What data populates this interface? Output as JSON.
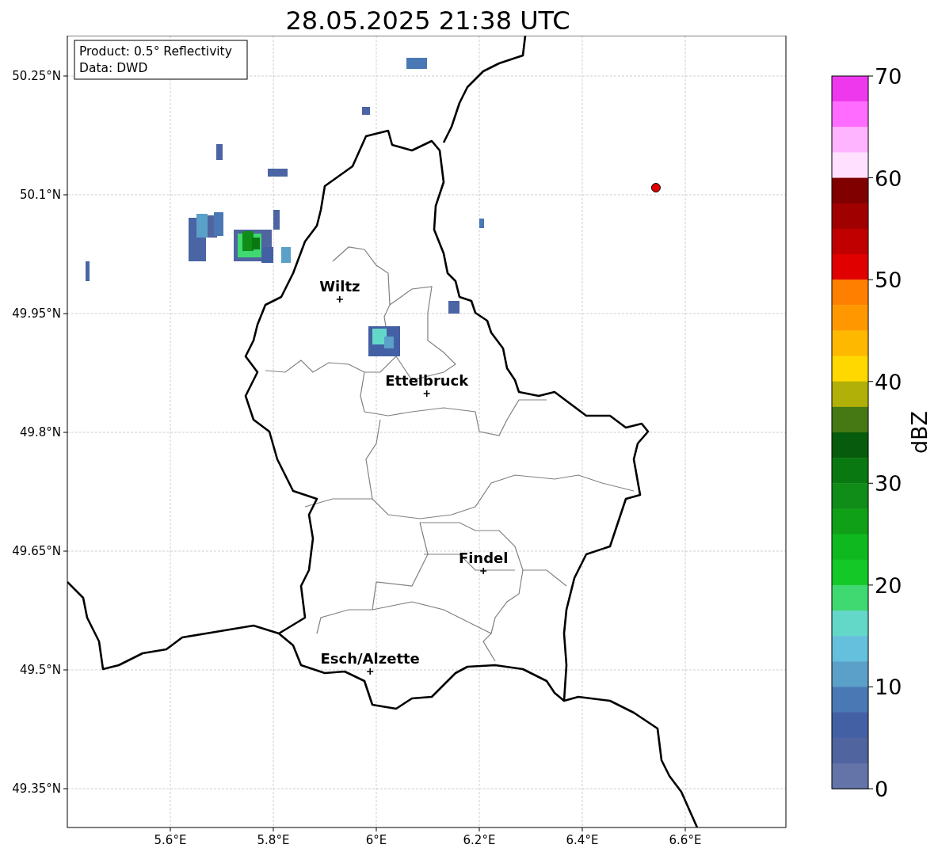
{
  "title": "28.05.2025 21:38 UTC",
  "info_box": [
    "Product: 0.5° Reflectivity",
    "Data: DWD"
  ],
  "map": {
    "chart_data": {
      "type": "scatter",
      "xlim": [
        5.4,
        6.7954
      ],
      "ylim": [
        49.301,
        50.301
      ],
      "grid": true,
      "xticks": [
        {
          "value": 5.6,
          "label": "5.6°E"
        },
        {
          "value": 5.8,
          "label": "5.8°E"
        },
        {
          "value": 6.0,
          "label": "6°E"
        },
        {
          "value": 6.2,
          "label": "6.2°E"
        },
        {
          "value": 6.4,
          "label": "6.4°E"
        },
        {
          "value": 6.6,
          "label": "6.6°E"
        }
      ],
      "yticks": [
        {
          "value": 50.25,
          "label": "50.25°N"
        },
        {
          "value": 50.1,
          "label": "50.1°N"
        },
        {
          "value": 49.95,
          "label": "49.95°N"
        },
        {
          "value": 49.8,
          "label": "49.8°N"
        },
        {
          "value": 49.65,
          "label": "49.65°N"
        },
        {
          "value": 49.5,
          "label": "49.5°N"
        },
        {
          "value": 49.35,
          "label": "49.35°N"
        }
      ],
      "x": [
        5.929,
        6.098,
        6.208,
        5.988,
        6.543
      ],
      "series": [
        {
          "color": "#000000",
          "values": [
            49.968,
            49.849,
            49.625,
            49.498,
            null
          ]
        },
        {
          "color": "#e00000",
          "values": [
            null,
            null,
            null,
            null,
            50.109
          ]
        }
      ],
      "annotations": [
        {
          "text": "Wiltz",
          "x": 5.929,
          "y": 49.968
        },
        {
          "text": "Ettelbruck",
          "x": 6.098,
          "y": 49.849
        },
        {
          "text": "Findel",
          "x": 6.208,
          "y": 49.625
        },
        {
          "text": "Esch/Alzette",
          "x": 5.988,
          "y": 49.498
        }
      ]
    }
  },
  "colorbar": {
    "label": "dBZ",
    "ticks": [
      "70",
      "60",
      "50",
      "40",
      "30",
      "20",
      "10",
      "0"
    ],
    "bands": [
      {
        "color": "#ee38ee"
      },
      {
        "color": "#ff6cff"
      },
      {
        "color": "#ffb4ff"
      },
      {
        "color": "#ffe0ff"
      },
      {
        "color": "#800000"
      },
      {
        "color": "#a00000"
      },
      {
        "color": "#c00000"
      },
      {
        "color": "#e00000"
      },
      {
        "color": "#ff8000"
      },
      {
        "color": "#ff9800"
      },
      {
        "color": "#ffb800"
      },
      {
        "color": "#ffd800"
      },
      {
        "color": "#b0b008"
      },
      {
        "color": "#467814"
      },
      {
        "color": "#065c0c"
      },
      {
        "color": "#0a7810"
      },
      {
        "color": "#108c18"
      },
      {
        "color": "#10a018"
      },
      {
        "color": "#10b820"
      },
      {
        "color": "#14c828"
      },
      {
        "color": "#40d870"
      },
      {
        "color": "#64d8c8"
      },
      {
        "color": "#64c0dc"
      },
      {
        "color": "#5aa0c8"
      },
      {
        "color": "#4a78b4"
      },
      {
        "color": "#4460a4"
      },
      {
        "color": "#5064a0"
      },
      {
        "color": "#6474a8"
      }
    ]
  }
}
